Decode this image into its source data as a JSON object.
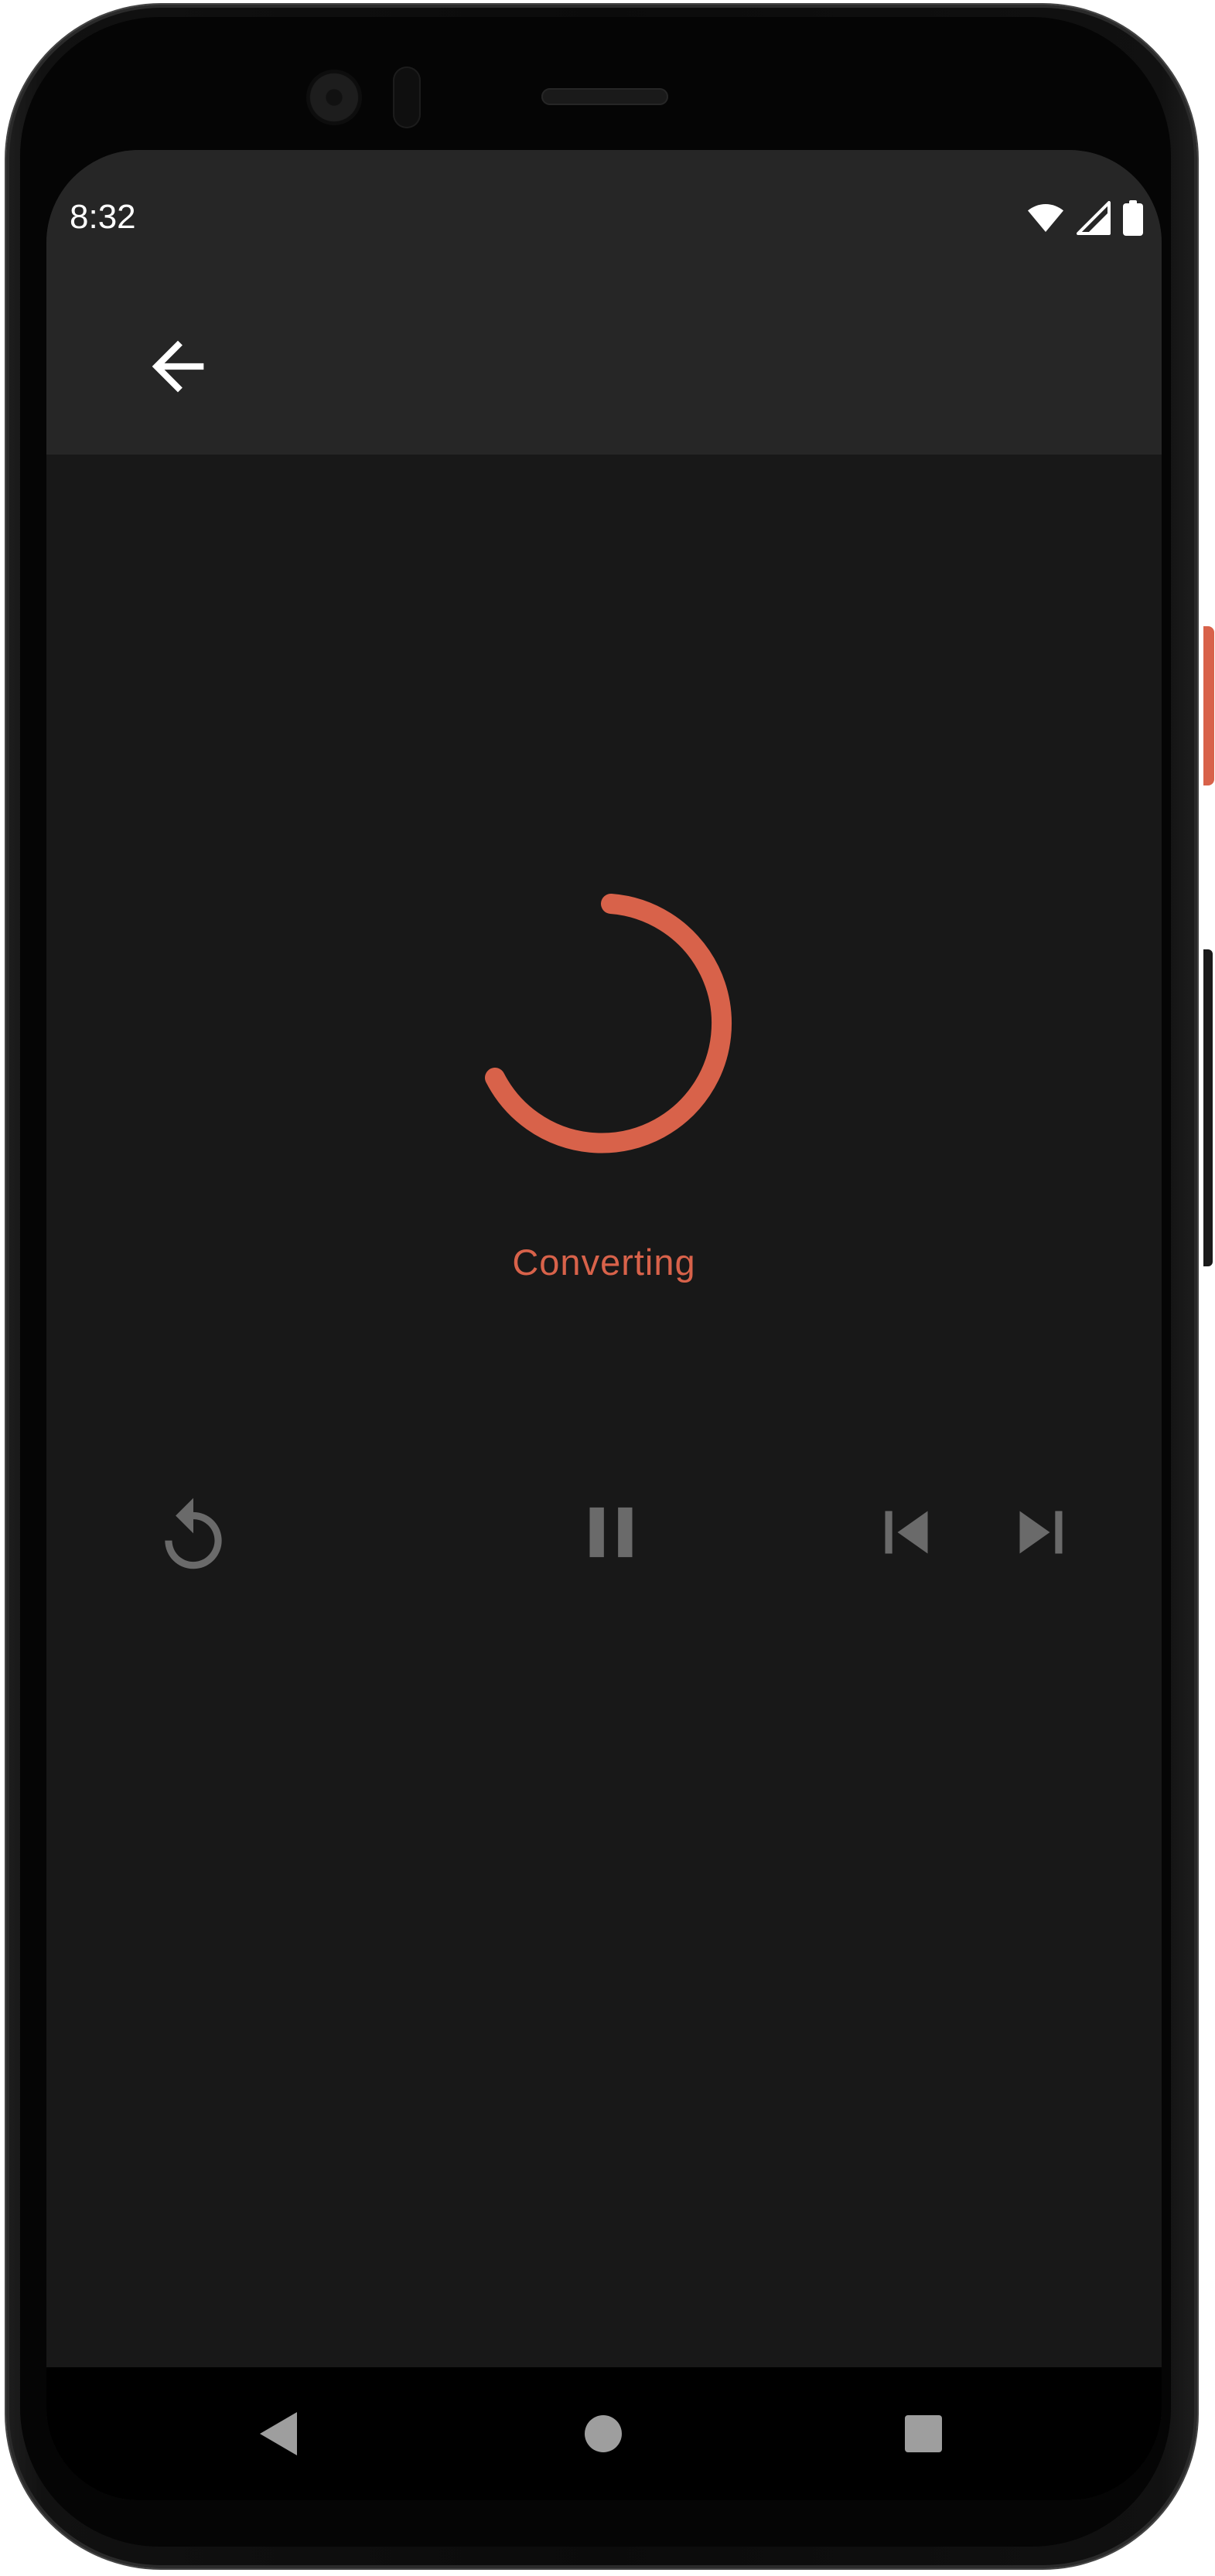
{
  "status_bar": {
    "time": "8:32",
    "icons": [
      "wifi-icon",
      "cell-signal-icon",
      "battery-icon"
    ]
  },
  "app_bar": {
    "back_icon": "arrow-back-icon"
  },
  "conversion": {
    "status_text": "Converting",
    "accent_color": "#d8624a"
  },
  "playback_controls": {
    "icons": [
      "replay-icon",
      "pause-icon",
      "skip-previous-icon",
      "skip-next-icon"
    ],
    "color": "#6a6a6a"
  },
  "navigation_bar": {
    "icons": [
      "nav-back-icon",
      "nav-home-icon",
      "nav-recents-icon"
    ],
    "color": "#9e9e9e"
  },
  "colors": {
    "background": "#181818",
    "app_bar": "#262626",
    "nav_bar": "#000000"
  }
}
